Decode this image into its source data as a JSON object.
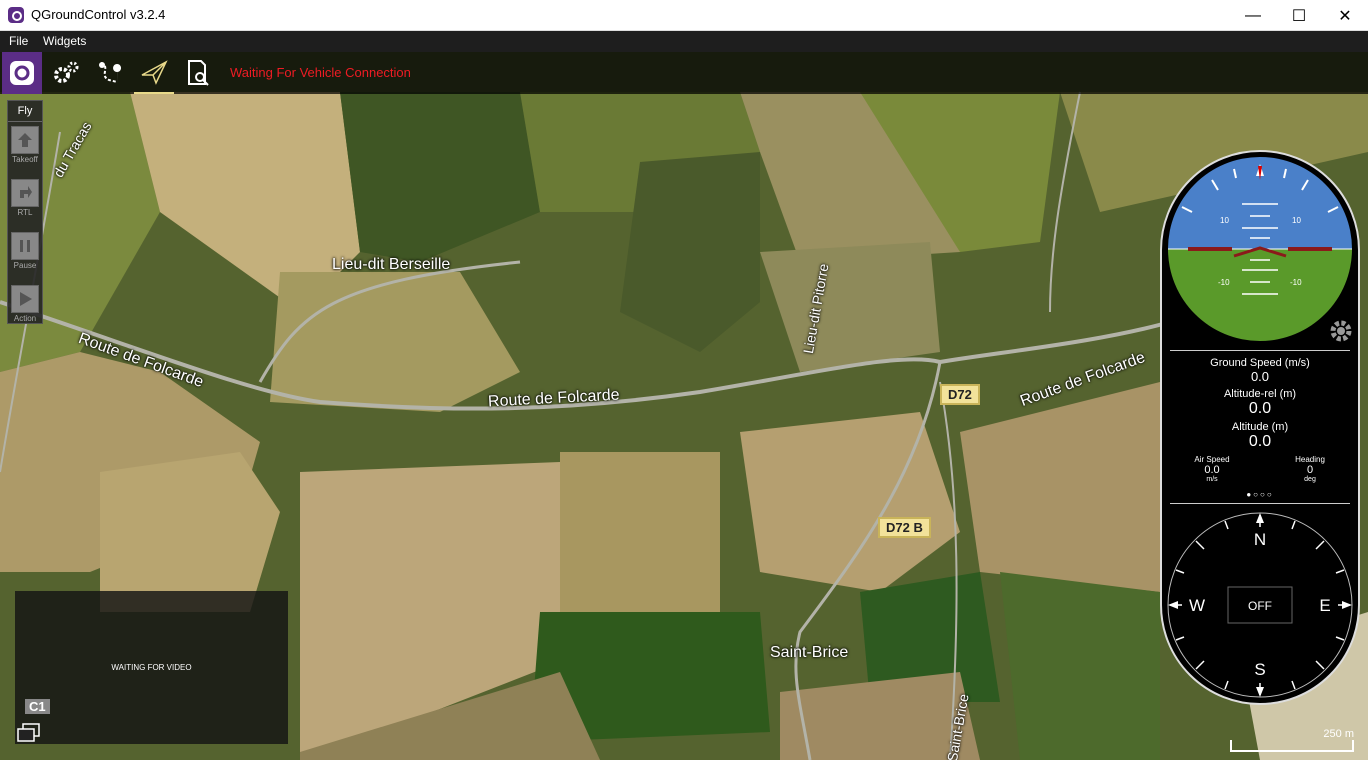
{
  "window": {
    "title": "QGroundControl v3.2.4",
    "minimize": "—",
    "maximize": "☐",
    "close": "✕"
  },
  "menu": {
    "file": "File",
    "widgets": "Widgets"
  },
  "toolbar": {
    "status": "Waiting For Vehicle Connection"
  },
  "flytools": {
    "header": "Fly",
    "items": [
      "Takeoff",
      "RTL",
      "Pause",
      "Action"
    ]
  },
  "video": {
    "text": "WAITING FOR VIDEO"
  },
  "map": {
    "labels": {
      "lieudit": "Lieu-dit Berseille",
      "route1": "Route de Folcarde",
      "route2": "Route de Folcarde",
      "route3": "Route de Folcarde",
      "pitorre": "Lieu-dit Pitorre",
      "saintbrice": "Saint-Brice",
      "tracas": "du Tracas",
      "stbrice_road": "Saint-Brice",
      "c1": "C1"
    },
    "signs": {
      "d72": "D72",
      "d72b": "D72 B"
    },
    "scale": "250 m"
  },
  "instruments": {
    "attitude": {
      "pitch_up": "10",
      "pitch_down": "-10"
    },
    "ground_speed": {
      "label": "Ground Speed (m/s)",
      "value": "0.0"
    },
    "altitude_rel": {
      "label": "Altitude-rel (m)",
      "value": "0.0"
    },
    "altitude": {
      "label": "Altitude (m)",
      "value": "0.0"
    },
    "air_speed": {
      "label": "Air Speed",
      "value": "0.0",
      "unit": "m/s"
    },
    "heading": {
      "label": "Heading",
      "value": "0",
      "unit": "deg"
    },
    "compass": {
      "n": "N",
      "s": "S",
      "e": "E",
      "w": "W",
      "mode": "OFF"
    }
  },
  "colors": {
    "sky": "#4a80c9",
    "ground": "#5a9a2a",
    "status_red": "#ee1c24",
    "accent": "#e8d98a"
  }
}
